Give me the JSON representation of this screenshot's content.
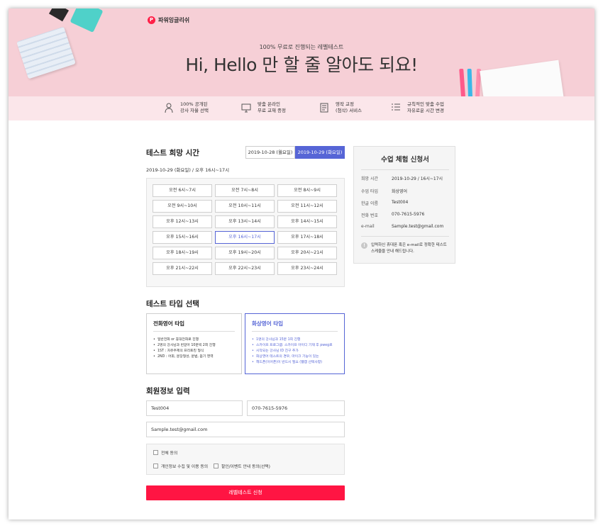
{
  "brand": {
    "logo_mark": "P",
    "name": "파워잉글리쉬"
  },
  "hero": {
    "subtitle": "100% 무료로 진행되는 레벨테스트",
    "title": "Hi, Hello 만 할 줄 알아도 되요!"
  },
  "features": [
    {
      "icon": "teacher-icon",
      "line1": "100% 공개된",
      "line2": "강사 자율 선택"
    },
    {
      "icon": "monitor-icon",
      "line1": "맞춤 온라인",
      "line2": "무료 교재 증정"
    },
    {
      "icon": "document-icon",
      "line1": "영작 교정",
      "line2": "(첨삭) 서비스"
    },
    {
      "icon": "schedule-list-icon",
      "line1": "규칙적인 맞춤 수업",
      "line2": "자유로운 시간 변경"
    }
  ],
  "time_section": {
    "title": "테스트 희망 시간",
    "dates": [
      "2019-10-28 (월요일)",
      "2019-10-29 (화요일)"
    ],
    "active_date_index": 1,
    "selected_label": "2019-10-29 (화요일) / 오후 16시~17시",
    "slots": [
      "오전 6시~7시",
      "오전 7시~8시",
      "오전 8시~9시",
      "오전 9시~10시",
      "오전 10시~11시",
      "오전 11시~12시",
      "오후 12시~13시",
      "오후 13시~14시",
      "오후 14시~15시",
      "오후 15시~16시",
      "오후 16시~17시",
      "오후 17시~18시",
      "오후 18시~19시",
      "오후 19시~20시",
      "오후 20시~21시",
      "오후 21시~22시",
      "오후 22시~23시",
      "오후 23시~24시"
    ],
    "active_slot_index": 10
  },
  "type_section": {
    "title": "테스트 타입 선택",
    "types": [
      {
        "title": "전화영어 타입",
        "items": [
          "일반전화 or 휴대전화로 진행",
          "2명의 강사님과 번갈아 10분씩 2회 진행",
          "1ST : 자유주제의 프리토킹 형식",
          "2ND : 어휘, 문장형성, 문법, 듣기 영역"
        ]
      },
      {
        "title": "화상영어 타입",
        "items": [
          "1명의 강사님과 15분 1회 진행",
          "스카이프 프로그램: 스카이프 아이디 기재 후 pweg로",
          "시작되는 강사님 ID 친구 추가",
          "화상영어 테스트의 경우, 마이크 기능이 있는",
          "헤드폰(이어폰)이 반드시 필요 (웹캠 선택사항)"
        ]
      }
    ],
    "active_type_index": 1
  },
  "member_section": {
    "title": "회원정보 입력",
    "name_value": "Test004",
    "phone_value": "070-7615-5976",
    "email_value": "Sample.test@gmail.com",
    "agree_all": "전체 동의",
    "agree_privacy": "개인정보 수집 및 이용 동의",
    "agree_marketing": "할인/이벤트 안내 동의(선택)",
    "submit": "레벨테스트 신청"
  },
  "summary": {
    "title": "수업 체험 신청서",
    "rows": [
      {
        "key": "희망 시간",
        "value": "2019-10-29 / 16시~17시"
      },
      {
        "key": "수업 타입",
        "value": "화상영어"
      },
      {
        "key": "한글 이름",
        "value": "Test004"
      },
      {
        "key": "전화 번호",
        "value": "070-7615-5976"
      },
      {
        "key": "e-mail",
        "value": "Sample.test@gmail.com"
      }
    ],
    "notice_icon": "!",
    "notice": "입력하신 휴대폰 혹은 e-mail로 정확한 테스트 스케줄을 안내 해드립니다."
  }
}
